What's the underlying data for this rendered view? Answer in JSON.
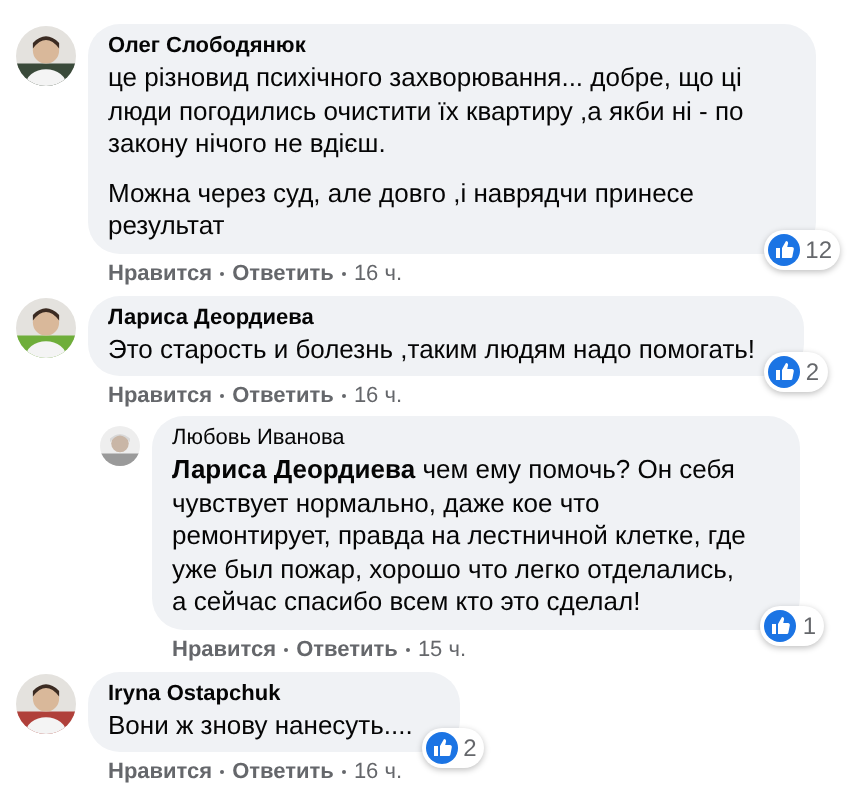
{
  "comments": [
    {
      "author": "Олег Слободянюк",
      "avatar": {
        "kind": "picture"
      },
      "paragraphs": [
        "це різновид психічного захворювання... добре, що ці люди погодились очистити їх квартиру ,а якби ні - по закону нічого не вдієш.",
        "Можна через суд, але довго ,і наврядчи принесе результат"
      ],
      "reactions": "12",
      "actions": {
        "like": "Нравится",
        "reply": "Ответить",
        "time": "16 ч."
      }
    },
    {
      "author": "Лариса Деордиева",
      "avatar": {
        "kind": "picture"
      },
      "paragraphs": [
        "Это старость и болезнь ,таким людям надо помогать!"
      ],
      "reactions": "2",
      "actions": {
        "like": "Нравится",
        "reply": "Ответить",
        "time": "16 ч."
      },
      "replies": [
        {
          "author": "Любовь Иванова",
          "avatar": {
            "kind": "picture"
          },
          "paragraphs": [
            "**Лариса Деордиева** чем ему помочь? Он себя чувствует нормально, даже кое что ремонтирует, правда на лестничной клетке, где уже был пожар, хорошо что легко отделались, а сейчас спасибо всем кто это сделал!"
          ],
          "reactions": "1",
          "actions": {
            "like": "Нравится",
            "reply": "Ответить",
            "time": "15 ч."
          }
        }
      ]
    },
    {
      "author": "Iryna Ostapchuk",
      "avatar": {
        "kind": "picture"
      },
      "paragraphs": [
        "Вони ж знову нанесуть...."
      ],
      "reactions": "2",
      "actions": {
        "like": "Нравится",
        "reply": "Ответить",
        "time": "16 ч."
      }
    }
  ]
}
